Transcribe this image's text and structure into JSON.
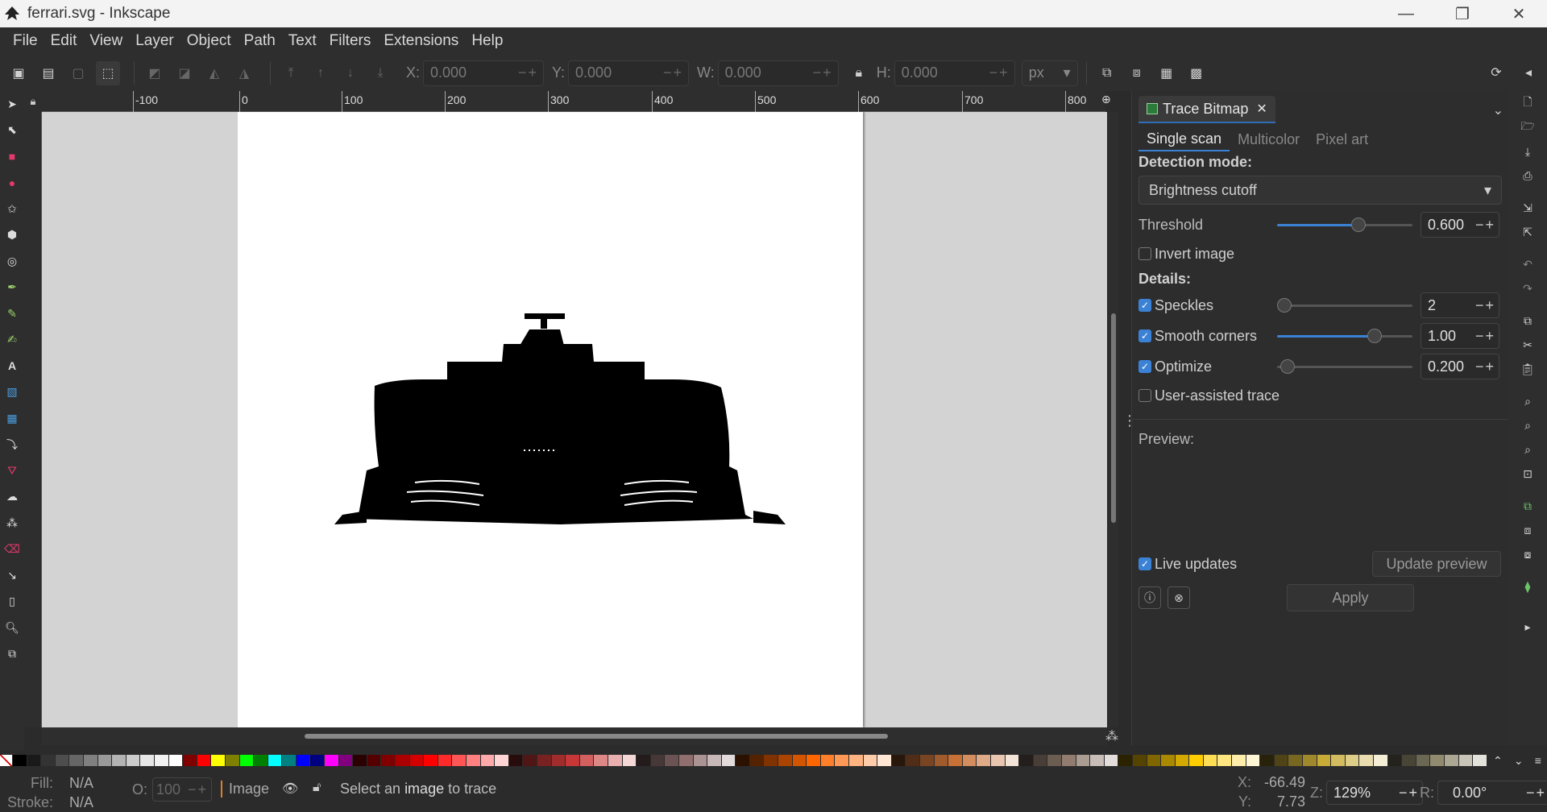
{
  "window": {
    "title": "ferrari.svg - Inkscape",
    "controls": [
      "—",
      "❐",
      "✕"
    ]
  },
  "menu": [
    "File",
    "Edit",
    "View",
    "Layer",
    "Object",
    "Path",
    "Text",
    "Filters",
    "Extensions",
    "Help"
  ],
  "toolbar": {
    "x_label": "X:",
    "x_value": "0.000",
    "y_label": "Y:",
    "y_value": "0.000",
    "w_label": "W:",
    "w_value": "0.000",
    "h_label": "H:",
    "h_value": "0.000",
    "unit": "px",
    "pm": "−+"
  },
  "ruler": {
    "labels": [
      "-100",
      "0",
      "100",
      "200",
      "300",
      "400",
      "500",
      "600",
      "700",
      "800"
    ]
  },
  "trace": {
    "tab_title": "Trace Bitmap",
    "modes": [
      "Single scan",
      "Multicolor",
      "Pixel art"
    ],
    "detection_mode_label": "Detection mode:",
    "detection_mode_value": "Brightness cutoff",
    "threshold_label": "Threshold",
    "threshold_value": "0.600",
    "threshold_fraction": 0.6,
    "invert_label": "Invert image",
    "details_label": "Details:",
    "speckles_label": "Speckles",
    "speckles_value": "2",
    "smooth_label": "Smooth corners",
    "smooth_value": "1.00",
    "optimize_label": "Optimize",
    "optimize_value": "0.200",
    "user_assisted_label": "User-assisted trace",
    "preview_label": "Preview:",
    "live_updates_label": "Live updates",
    "update_preview_label": "Update preview",
    "apply_label": "Apply",
    "pm": "−+"
  },
  "palette": {
    "colors": [
      "#000000",
      "#1a1a1a",
      "#333333",
      "#4d4d4d",
      "#666666",
      "#808080",
      "#999999",
      "#b3b3b3",
      "#cccccc",
      "#e6e6e6",
      "#f2f2f2",
      "#ffffff",
      "#800000",
      "#ff0000",
      "#ffff00",
      "#808000",
      "#00ff00",
      "#008000",
      "#00ffff",
      "#008080",
      "#0000ff",
      "#000080",
      "#ff00ff",
      "#800080",
      "#2b0000",
      "#550000",
      "#800000",
      "#aa0000",
      "#d40000",
      "#ff0000",
      "#ff2a2a",
      "#ff5555",
      "#ff8080",
      "#ffaaaa",
      "#ffd5d5",
      "#280b0b",
      "#501616",
      "#782121",
      "#a02c2c",
      "#c83737",
      "#d35f5f",
      "#de8787",
      "#e9afaf",
      "#f4d7d7",
      "#241c1c",
      "#483737",
      "#6c5353",
      "#916f6f",
      "#ac9393",
      "#c8b7b7",
      "#e3dbdb",
      "#2b1100",
      "#552200",
      "#803300",
      "#aa4400",
      "#d45500",
      "#ff6600",
      "#ff7f2a",
      "#ff9955",
      "#ffb380",
      "#ffccaa",
      "#ffe6d5",
      "#28170b",
      "#502d16",
      "#784421",
      "#a05a2c",
      "#c87137",
      "#d38d5f",
      "#deaa87",
      "#e9c6af",
      "#f4e3d7",
      "#241f1c",
      "#483e37",
      "#6c5d53",
      "#917c6f",
      "#ac9d93",
      "#c8beb7",
      "#e3dedb",
      "#2b2200",
      "#554400",
      "#806600",
      "#aa8800",
      "#d4aa00",
      "#ffcc00",
      "#ffdd55",
      "#ffe680",
      "#ffeeaa",
      "#fff6d5",
      "#28220b",
      "#504416",
      "#786721",
      "#a0892c",
      "#c8ab37",
      "#d3bc5f",
      "#decd87",
      "#e9ddaf",
      "#f4eed7",
      "#24221c",
      "#484537",
      "#6c6753",
      "#918a6f",
      "#aca793",
      "#c8c4b7",
      "#e3e2db"
    ]
  },
  "status": {
    "fill_label": "Fill:",
    "fill_value": "N/A",
    "stroke_label": "Stroke:",
    "stroke_value": "N/A",
    "opacity_label": "O:",
    "opacity_value": "100",
    "layer": "Image",
    "message_pre": "Select an ",
    "message_bold": "image",
    "message_post": " to trace",
    "x_label": "X:",
    "x_value": "-66.49",
    "y_label": "Y:",
    "y_value": "7.73",
    "zoom_label": "Z:",
    "zoom_value": "129%",
    "rotate_label": "R:",
    "rotate_value": "0.00°",
    "pm": "−+"
  }
}
